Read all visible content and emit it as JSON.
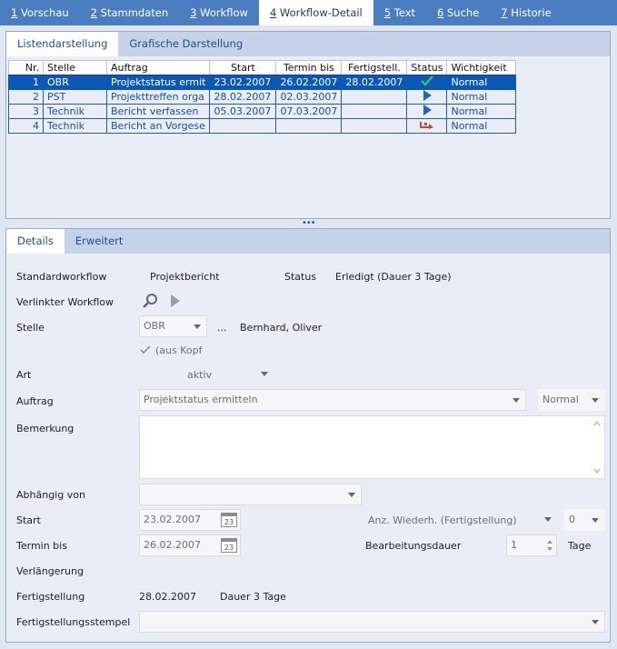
{
  "top_tabs": [
    {
      "num": "1",
      "label": "Vorschau"
    },
    {
      "num": "2",
      "label": "Stammdaten"
    },
    {
      "num": "3",
      "label": "Workflow"
    },
    {
      "num": "4",
      "label": "Workflow-Detail"
    },
    {
      "num": "5",
      "label": "Text"
    },
    {
      "num": "6",
      "label": "Suche"
    },
    {
      "num": "7",
      "label": "Historie"
    }
  ],
  "upper_tabs": [
    "Listendarstellung",
    "Grafische Darstellung"
  ],
  "grid": {
    "headers": [
      "Nr.",
      "Stelle",
      "Auftrag",
      "Start",
      "Termin bis",
      "Fertigstell.",
      "Status",
      "Wichtigkeit"
    ],
    "rows": [
      {
        "nr": "1",
        "stelle": "OBR",
        "auftrag": "Projektstatus ermit",
        "start": "23.02.2007",
        "termin": "26.02.2007",
        "fertig": "28.02.2007",
        "status": "done",
        "wichtigkeit": "Normal"
      },
      {
        "nr": "2",
        "stelle": "PST",
        "auftrag": "Projekttreffen orga",
        "start": "28.02.2007",
        "termin": "02.03.2007",
        "fertig": "",
        "status": "play",
        "wichtigkeit": "Normal"
      },
      {
        "nr": "3",
        "stelle": "Technik",
        "auftrag": "Bericht verfassen",
        "start": "05.03.2007",
        "termin": "07.03.2007",
        "fertig": "",
        "status": "play",
        "wichtigkeit": "Normal"
      },
      {
        "nr": "4",
        "stelle": "Technik",
        "auftrag": "Bericht an Vorgese",
        "start": "",
        "termin": "",
        "fertig": "",
        "status": "waiting",
        "wichtigkeit": "Normal"
      }
    ]
  },
  "splitter": "•••",
  "detail_tabs": [
    "Details",
    "Erweitert"
  ],
  "details": {
    "standardworkflow_label": "Standardworkflow",
    "standardworkflow_value": "Projektbericht",
    "status_label": "Status",
    "status_value": "Erledigt (Dauer 3 Tage)",
    "verlinkter_label": "Verlinkter Workflow",
    "stelle_label": "Stelle",
    "stelle_value": "OBR",
    "stelle_more": "...",
    "stelle_person": "Bernhard, Oliver",
    "aus_kopf": "(aus Kopf",
    "art_label": "Art",
    "art_value": "aktiv",
    "auftrag_label": "Auftrag",
    "auftrag_value": "Projektstatus ermitteln",
    "wichtigkeit_value": "Normal",
    "bemerkung_label": "Bemerkung",
    "bemerkung_value": "",
    "abhaengig_label": "Abhängig von",
    "abhaengig_value": "",
    "start_label": "Start",
    "start_value": "23.02.2007",
    "anz_label": "Anz. Wiederh. (Fertigstellung)",
    "anz_value": "0",
    "termin_label": "Termin bis",
    "termin_value": "26.02.2007",
    "bearb_label": "Bearbeitungsdauer",
    "bearb_value": "1",
    "bearb_unit": "Tage",
    "verlaengerung_label": "Verlängerung",
    "fertig_label": "Fertigstellung",
    "fertig_value": "28.02.2007",
    "fertig_dauer": "Dauer 3 Tage",
    "stempel_label": "Fertigstellungsstempel",
    "stempel_value": "",
    "cal_day": "23"
  },
  "colors": {
    "tabbar": "#4a7cc0",
    "selected_row": "#0b57b8",
    "link_text": "#1e4d8f",
    "status_done": "#2da44e",
    "status_play": "#2b63b5",
    "status_wait": "#d2472a"
  }
}
